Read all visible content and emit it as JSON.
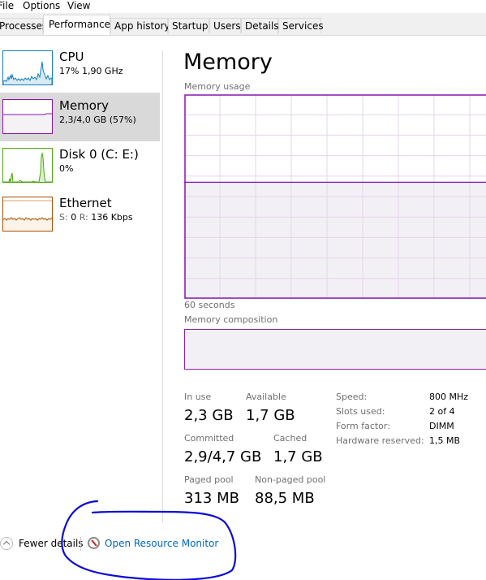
{
  "menu": {
    "items": [
      "File",
      "Options",
      "View"
    ]
  },
  "tabs": [
    {
      "label": "Processes",
      "active": false
    },
    {
      "label": "Performance",
      "active": true
    },
    {
      "label": "App history",
      "active": false
    },
    {
      "label": "Startup",
      "active": false
    },
    {
      "label": "Users",
      "active": false
    },
    {
      "label": "Details",
      "active": false
    },
    {
      "label": "Services",
      "active": false
    }
  ],
  "sidebar": {
    "items": [
      {
        "title": "CPU",
        "subtitle": "17%  1,90 GHz",
        "color": "#117dbb",
        "selected": false
      },
      {
        "title": "Memory",
        "subtitle": "2,3/4,0 GB (57%)",
        "color": "#8b12ae",
        "selected": true
      },
      {
        "title": "Disk 0 (C: E:)",
        "subtitle": "0%",
        "color": "#4da60c",
        "selected": false
      },
      {
        "title": "Ethernet",
        "subtitle_s_label": "S:",
        "subtitle_s_value": "0",
        "subtitle_r_label": "R:",
        "subtitle_r_value": "136 Kbps",
        "color": "#a74f01",
        "selected": false
      }
    ]
  },
  "main": {
    "title": "Memory",
    "usage_label": "Memory usage",
    "time_label": "60 seconds",
    "composition_label": "Memory composition",
    "accent_color": "#8b12ae",
    "usage_percent": 57,
    "stats": {
      "in_use": {
        "label": "In use",
        "value": "2,3 GB"
      },
      "available": {
        "label": "Available",
        "value": "1,7 GB"
      },
      "committed": {
        "label": "Committed",
        "value": "2,9/4,7 GB"
      },
      "cached": {
        "label": "Cached",
        "value": "1,7 GB"
      },
      "paged_pool": {
        "label": "Paged pool",
        "value": "313 MB"
      },
      "non_paged_pool": {
        "label": "Non-paged pool",
        "value": "88,5 MB"
      }
    },
    "details": [
      {
        "label": "Speed:",
        "value": "800 MHz"
      },
      {
        "label": "Slots used:",
        "value": "2 of 4"
      },
      {
        "label": "Form factor:",
        "value": "DIMM"
      },
      {
        "label": "Hardware reserved:",
        "value": "1,5 MB"
      }
    ]
  },
  "footer": {
    "fewer_details": "Fewer details",
    "resource_monitor": "Open Resource Monitor"
  },
  "annotation": {
    "color": "#0a0ad6"
  }
}
